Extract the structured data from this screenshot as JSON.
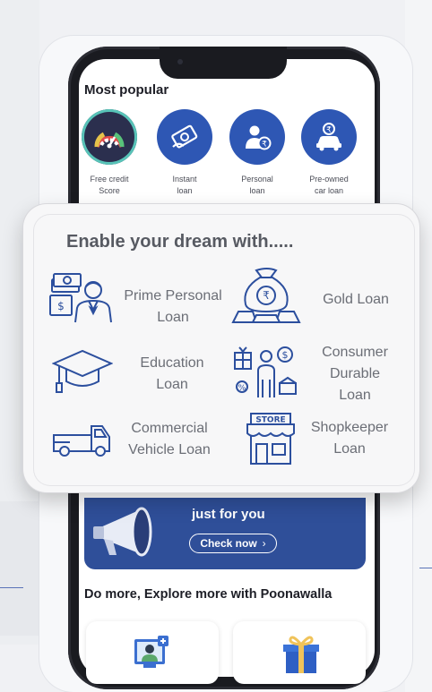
{
  "most_popular": {
    "title": "Most popular",
    "items": [
      {
        "label_line1": "Free credit",
        "label_line2": "Score",
        "icon": "credit-score-gauge-icon"
      },
      {
        "label_line1": "Instant",
        "label_line2": "loan",
        "icon": "instant-loan-icon"
      },
      {
        "label_line1": "Personal",
        "label_line2": "loan",
        "icon": "personal-loan-icon"
      },
      {
        "label_line1": "Pre-owned",
        "label_line2": "car loan",
        "icon": "car-loan-icon"
      }
    ]
  },
  "dream_card": {
    "title": "Enable your dream with.....",
    "loans": [
      {
        "line1": "Prime Personal",
        "line2": "Loan",
        "icon": "person-cash-icon"
      },
      {
        "line1": "Gold Loan",
        "line2": "",
        "icon": "money-bag-gold-icon"
      },
      {
        "line1": "Education",
        "line2": "Loan",
        "icon": "graduation-cap-icon"
      },
      {
        "line1": "Consumer",
        "line2": "Durable",
        "line3": "Loan",
        "icon": "consumer-durable-icon"
      },
      {
        "line1": "Commercial",
        "line2": "Vehicle Loan",
        "icon": "truck-icon"
      },
      {
        "line1": "Shopkeeper",
        "line2": "Loan",
        "store_sign": "STORE",
        "icon": "store-icon"
      }
    ]
  },
  "banner": {
    "headline": "just for you",
    "cta": "Check now",
    "cta_icon": "chevron-right-icon",
    "icon": "megaphone-icon"
  },
  "explore": {
    "title": "Do more, Explore more with Poonawalla",
    "tiles": [
      {
        "icon": "online-doctor-icon"
      },
      {
        "icon": "gift-box-icon"
      }
    ]
  },
  "colors": {
    "brand_blue": "#2e57b4",
    "icon_blue": "#2c4f9e",
    "banner_blue": "#2f4f99",
    "card_bg": "#f7f7f8",
    "title_gray": "#575a62"
  }
}
